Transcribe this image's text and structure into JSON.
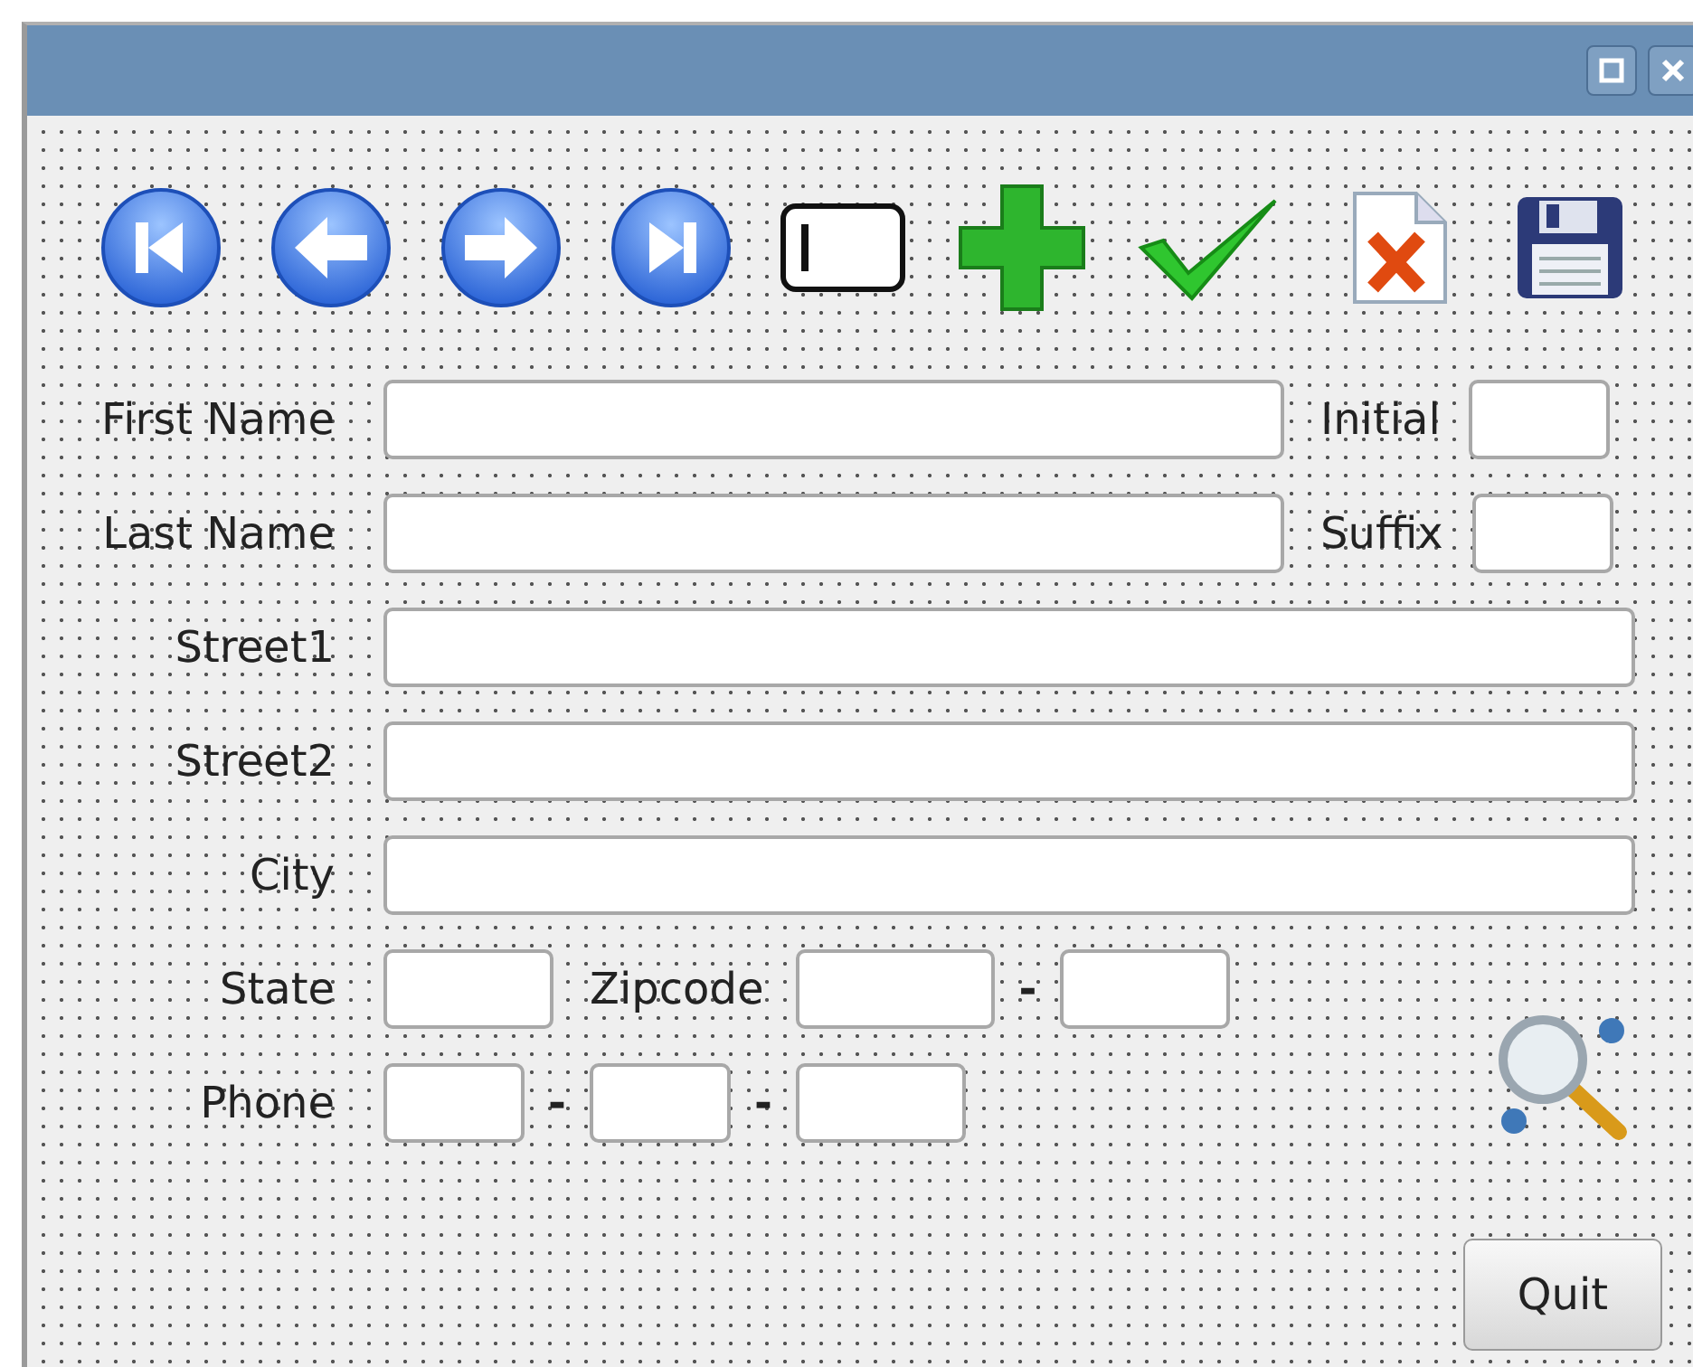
{
  "form": {
    "rows": [
      {
        "kind": "name",
        "label": "First Name",
        "side_label": "Initial"
      },
      {
        "kind": "name",
        "label": "Last Name",
        "side_label": "Suffix"
      },
      {
        "kind": "full",
        "label": "Street1"
      },
      {
        "kind": "full",
        "label": "Street2"
      },
      {
        "kind": "full",
        "label": "City"
      },
      {
        "kind": "state",
        "label": "State",
        "zip_label": "Zipcode",
        "separator": "-"
      },
      {
        "kind": "phone",
        "label": "Phone",
        "separators": [
          "-",
          "-"
        ]
      }
    ]
  },
  "quit_button": "Quit"
}
